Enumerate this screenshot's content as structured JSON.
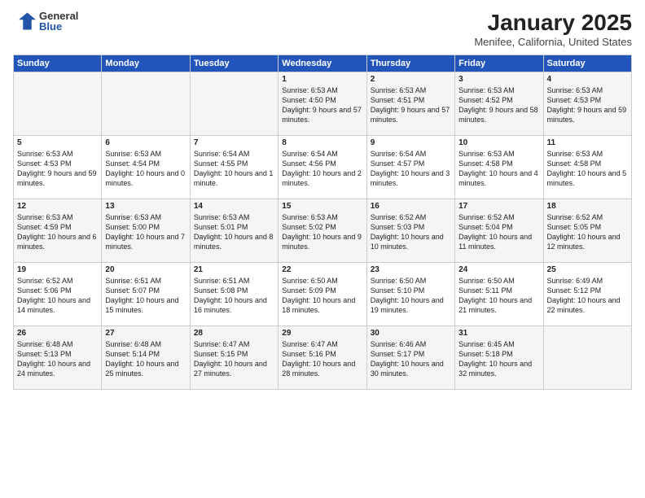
{
  "logo": {
    "general": "General",
    "blue": "Blue"
  },
  "calendar": {
    "title": "January 2025",
    "subtitle": "Menifee, California, United States",
    "days_of_week": [
      "Sunday",
      "Monday",
      "Tuesday",
      "Wednesday",
      "Thursday",
      "Friday",
      "Saturday"
    ],
    "weeks": [
      [
        {
          "day": null,
          "details": null
        },
        {
          "day": null,
          "details": null
        },
        {
          "day": null,
          "details": null
        },
        {
          "day": "1",
          "details": "Sunrise: 6:53 AM\nSunset: 4:50 PM\nDaylight: 9 hours\nand 57 minutes."
        },
        {
          "day": "2",
          "details": "Sunrise: 6:53 AM\nSunset: 4:51 PM\nDaylight: 9 hours\nand 57 minutes."
        },
        {
          "day": "3",
          "details": "Sunrise: 6:53 AM\nSunset: 4:52 PM\nDaylight: 9 hours\nand 58 minutes."
        },
        {
          "day": "4",
          "details": "Sunrise: 6:53 AM\nSunset: 4:53 PM\nDaylight: 9 hours\nand 59 minutes."
        }
      ],
      [
        {
          "day": "5",
          "details": "Sunrise: 6:53 AM\nSunset: 4:53 PM\nDaylight: 9 hours\nand 59 minutes."
        },
        {
          "day": "6",
          "details": "Sunrise: 6:53 AM\nSunset: 4:54 PM\nDaylight: 10 hours\nand 0 minutes."
        },
        {
          "day": "7",
          "details": "Sunrise: 6:54 AM\nSunset: 4:55 PM\nDaylight: 10 hours\nand 1 minute."
        },
        {
          "day": "8",
          "details": "Sunrise: 6:54 AM\nSunset: 4:56 PM\nDaylight: 10 hours\nand 2 minutes."
        },
        {
          "day": "9",
          "details": "Sunrise: 6:54 AM\nSunset: 4:57 PM\nDaylight: 10 hours\nand 3 minutes."
        },
        {
          "day": "10",
          "details": "Sunrise: 6:53 AM\nSunset: 4:58 PM\nDaylight: 10 hours\nand 4 minutes."
        },
        {
          "day": "11",
          "details": "Sunrise: 6:53 AM\nSunset: 4:58 PM\nDaylight: 10 hours\nand 5 minutes."
        }
      ],
      [
        {
          "day": "12",
          "details": "Sunrise: 6:53 AM\nSunset: 4:59 PM\nDaylight: 10 hours\nand 6 minutes."
        },
        {
          "day": "13",
          "details": "Sunrise: 6:53 AM\nSunset: 5:00 PM\nDaylight: 10 hours\nand 7 minutes."
        },
        {
          "day": "14",
          "details": "Sunrise: 6:53 AM\nSunset: 5:01 PM\nDaylight: 10 hours\nand 8 minutes."
        },
        {
          "day": "15",
          "details": "Sunrise: 6:53 AM\nSunset: 5:02 PM\nDaylight: 10 hours\nand 9 minutes."
        },
        {
          "day": "16",
          "details": "Sunrise: 6:52 AM\nSunset: 5:03 PM\nDaylight: 10 hours\nand 10 minutes."
        },
        {
          "day": "17",
          "details": "Sunrise: 6:52 AM\nSunset: 5:04 PM\nDaylight: 10 hours\nand 11 minutes."
        },
        {
          "day": "18",
          "details": "Sunrise: 6:52 AM\nSunset: 5:05 PM\nDaylight: 10 hours\nand 12 minutes."
        }
      ],
      [
        {
          "day": "19",
          "details": "Sunrise: 6:52 AM\nSunset: 5:06 PM\nDaylight: 10 hours\nand 14 minutes."
        },
        {
          "day": "20",
          "details": "Sunrise: 6:51 AM\nSunset: 5:07 PM\nDaylight: 10 hours\nand 15 minutes."
        },
        {
          "day": "21",
          "details": "Sunrise: 6:51 AM\nSunset: 5:08 PM\nDaylight: 10 hours\nand 16 minutes."
        },
        {
          "day": "22",
          "details": "Sunrise: 6:50 AM\nSunset: 5:09 PM\nDaylight: 10 hours\nand 18 minutes."
        },
        {
          "day": "23",
          "details": "Sunrise: 6:50 AM\nSunset: 5:10 PM\nDaylight: 10 hours\nand 19 minutes."
        },
        {
          "day": "24",
          "details": "Sunrise: 6:50 AM\nSunset: 5:11 PM\nDaylight: 10 hours\nand 21 minutes."
        },
        {
          "day": "25",
          "details": "Sunrise: 6:49 AM\nSunset: 5:12 PM\nDaylight: 10 hours\nand 22 minutes."
        }
      ],
      [
        {
          "day": "26",
          "details": "Sunrise: 6:48 AM\nSunset: 5:13 PM\nDaylight: 10 hours\nand 24 minutes."
        },
        {
          "day": "27",
          "details": "Sunrise: 6:48 AM\nSunset: 5:14 PM\nDaylight: 10 hours\nand 25 minutes."
        },
        {
          "day": "28",
          "details": "Sunrise: 6:47 AM\nSunset: 5:15 PM\nDaylight: 10 hours\nand 27 minutes."
        },
        {
          "day": "29",
          "details": "Sunrise: 6:47 AM\nSunset: 5:16 PM\nDaylight: 10 hours\nand 28 minutes."
        },
        {
          "day": "30",
          "details": "Sunrise: 6:46 AM\nSunset: 5:17 PM\nDaylight: 10 hours\nand 30 minutes."
        },
        {
          "day": "31",
          "details": "Sunrise: 6:45 AM\nSunset: 5:18 PM\nDaylight: 10 hours\nand 32 minutes."
        },
        {
          "day": null,
          "details": null
        }
      ]
    ]
  }
}
